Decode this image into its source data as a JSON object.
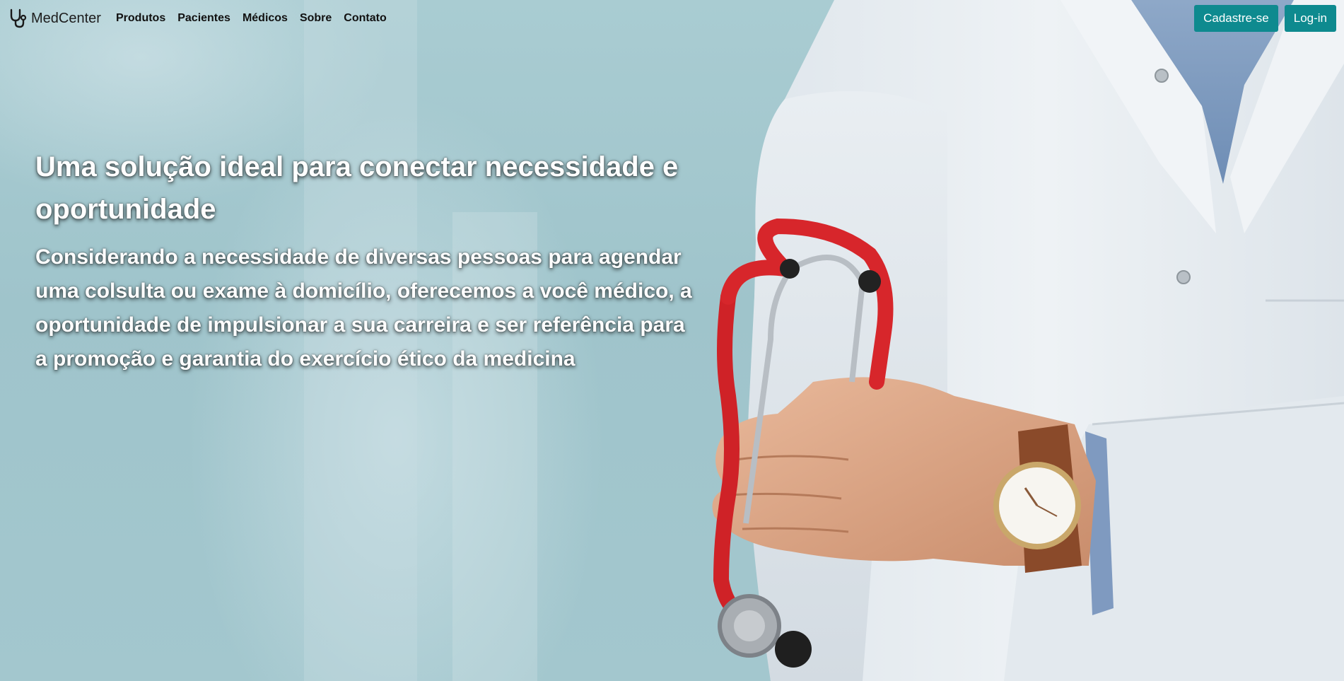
{
  "brand": {
    "name": "MedCenter",
    "icon": "stethoscope-icon"
  },
  "nav": {
    "items": [
      {
        "label": "Produtos"
      },
      {
        "label": "Pacientes"
      },
      {
        "label": "Médicos"
      },
      {
        "label": "Sobre"
      },
      {
        "label": "Contato"
      }
    ]
  },
  "actions": {
    "signup_label": "Cadastre-se",
    "login_label": "Log-in"
  },
  "hero": {
    "title": "Uma solução ideal para conectar necessidade e oportunidade",
    "subtitle": "Considerando a necessidade de diversas pessoas para agendar uma colsulta ou exame à domicílio, oferecemos a você médico, a oportunidade de impulsionar a sua carreira e ser referência para a promoção e garantia do exercício ético da medicina"
  },
  "colors": {
    "accent": "#0e8a8f",
    "background": "#a3c7ce",
    "text_light": "#ffffff"
  }
}
